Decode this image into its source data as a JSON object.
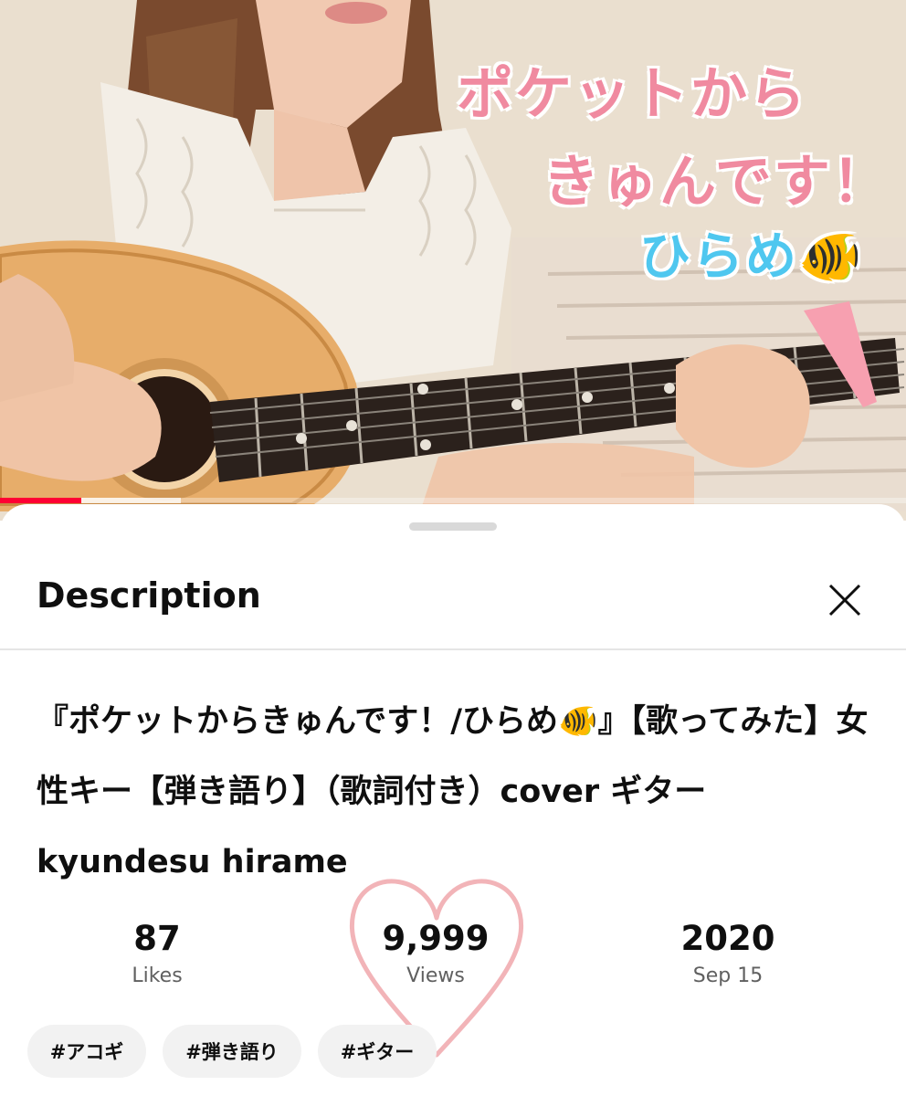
{
  "video": {
    "overlay_title_line1": "ポケットから",
    "overlay_title_line2": "きゅんです！",
    "overlay_artist": "ひらめ🐠",
    "progress": 0.09,
    "buffered": 0.2,
    "colors": {
      "overlay_pink": "#f08aa0",
      "overlay_blue": "#4fc7ef",
      "progress_red": "#ff0033"
    }
  },
  "sheet": {
    "title": "Description",
    "close_icon": "close-icon"
  },
  "description": {
    "title": "『ポケットからきゅんです！/ひらめ🐠』【歌ってみた】女性キー【弾き語り】（歌詞付き）cover ギター　kyundesu hirame"
  },
  "stats": {
    "likes_value": "87",
    "likes_label": "Likes",
    "views_value": "9,999",
    "views_label": "Views",
    "year_value": "2020",
    "date_label": "Sep 15"
  },
  "tags": [
    {
      "label": "#アコギ"
    },
    {
      "label": "#弾き語り"
    },
    {
      "label": "#ギター"
    }
  ]
}
